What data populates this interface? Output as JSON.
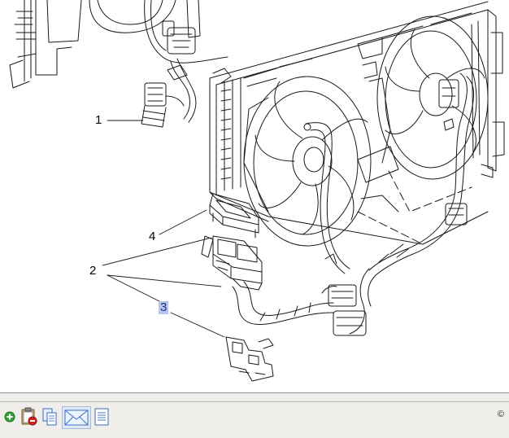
{
  "callouts": {
    "one": "1",
    "two": "2",
    "three": "3",
    "four": "4"
  },
  "toolbar": {
    "buttons": [
      {
        "icon": "add-icon"
      },
      {
        "icon": "clipboard-remove-icon"
      },
      {
        "icon": "copy-pages-icon"
      },
      {
        "icon": "email-icon"
      },
      {
        "icon": "document-list-icon"
      }
    ],
    "copyright": "©"
  },
  "colors": {
    "line": "#1a1a1a",
    "highlight": "#b8c6ee",
    "toolbar_bg": "#efeeea"
  }
}
